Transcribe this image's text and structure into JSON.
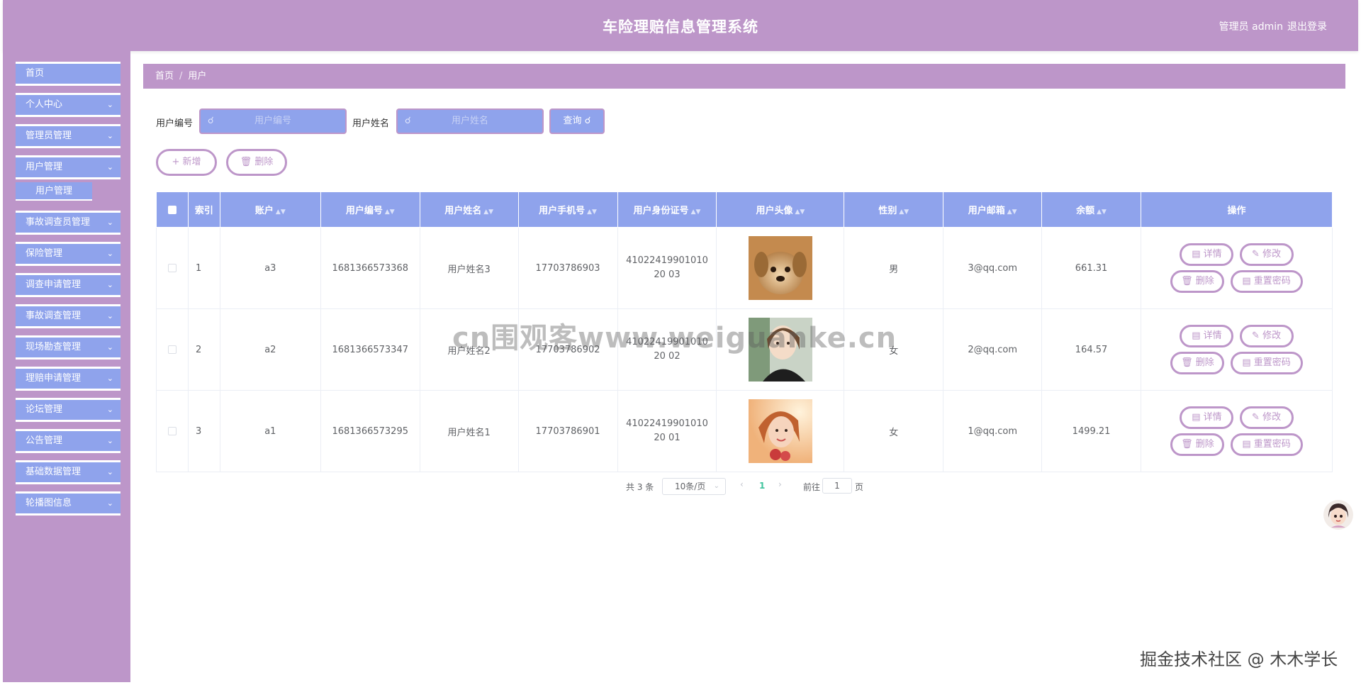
{
  "header": {
    "title": "车险理赔信息管理系统",
    "user": "管理员 admin",
    "logout": "退出登录"
  },
  "sidebar": {
    "items": [
      {
        "label": "首页"
      },
      {
        "label": "个人中心"
      },
      {
        "label": "管理员管理"
      },
      {
        "label": "用户管理"
      },
      {
        "label": "事故调查员管理"
      },
      {
        "label": "保险管理"
      },
      {
        "label": "调查申请管理"
      },
      {
        "label": "事故调查管理"
      },
      {
        "label": "现场勘查管理"
      },
      {
        "label": "理赔申请管理"
      },
      {
        "label": "论坛管理"
      },
      {
        "label": "公告管理"
      },
      {
        "label": "基础数据管理"
      },
      {
        "label": "轮播图信息"
      }
    ],
    "submenu_active": "用户管理"
  },
  "breadcrumb": {
    "home": "首页",
    "sep": "/",
    "current": "用户"
  },
  "search": {
    "field1_label": "用户编号",
    "field1_placeholder": "用户编号",
    "field2_label": "用户姓名",
    "field2_placeholder": "用户姓名",
    "query_label": "查询"
  },
  "actions": {
    "add_label": "新增",
    "delete_label": "删除"
  },
  "table": {
    "columns": [
      "索引",
      "账户",
      "用户编号",
      "用户姓名",
      "用户手机号",
      "用户身份证号",
      "用户头像",
      "性别",
      "用户邮箱",
      "余额",
      "操作"
    ],
    "rows": [
      {
        "index": "1",
        "account": "a3",
        "user_no": "1681366573368",
        "name": "用户姓名3",
        "phone": "17703786903",
        "id_card": "4102241990101020 03",
        "gender": "男",
        "email": "3@qq.com",
        "balance": "661.31"
      },
      {
        "index": "2",
        "account": "a2",
        "user_no": "1681366573347",
        "name": "用户姓名2",
        "phone": "17703786902",
        "id_card": "4102241990101020 02",
        "gender": "女",
        "email": "2@qq.com",
        "balance": "164.57"
      },
      {
        "index": "3",
        "account": "a1",
        "user_no": "1681366573295",
        "name": "用户姓名1",
        "phone": "17703786901",
        "id_card": "4102241990101020 01",
        "gender": "女",
        "email": "1@qq.com",
        "balance": "1499.21"
      }
    ],
    "op_labels": {
      "detail": "详情",
      "edit": "修改",
      "delete": "删除",
      "reset": "重置密码"
    }
  },
  "pager": {
    "total": "共 3 条",
    "page_size": "10条/页",
    "current_page": "1",
    "goto_label": "前往",
    "goto_value": "1",
    "page_suffix": "页"
  },
  "watermark": "cn围观客www.weiguanke.cn",
  "credit": "掘金技术社区 @ 木木学长",
  "colors": {
    "purple": "#bd96c9",
    "blue": "#8fa3ec",
    "active_page": "#3fc39d"
  }
}
